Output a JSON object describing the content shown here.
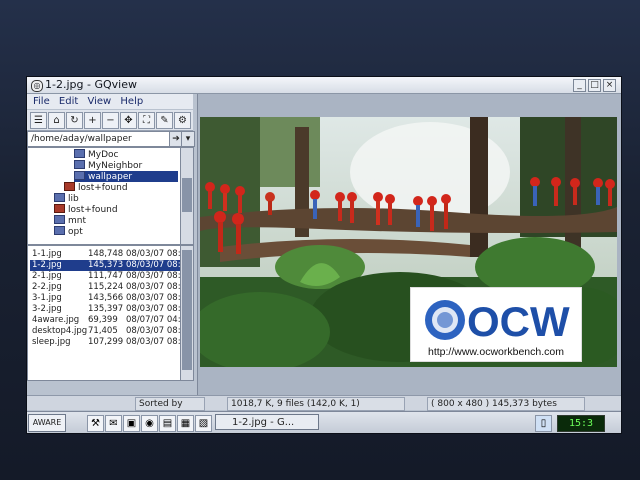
{
  "window": {
    "title": "1-2.jpg - GQview"
  },
  "menu": [
    "File",
    "Edit",
    "View",
    "Help"
  ],
  "path_field": {
    "value": "/home/aday/wallpaper"
  },
  "tree": {
    "items": [
      {
        "label": "MyDoc",
        "selected": false
      },
      {
        "label": "MyNeighbor",
        "selected": false
      },
      {
        "label": "wallpaper",
        "selected": true
      },
      {
        "label": "lost+found",
        "selected": false
      },
      {
        "label": "lib",
        "selected": false
      },
      {
        "label": "lost+found",
        "selected": false
      },
      {
        "label": "mnt",
        "selected": false
      },
      {
        "label": "opt",
        "selected": false
      }
    ]
  },
  "files": {
    "rows": [
      {
        "name": "1-1.jpg",
        "size": "148,748",
        "date": "08/03/07 08:",
        "selected": false
      },
      {
        "name": "1-2.jpg",
        "size": "145,373",
        "date": "08/03/07 08:",
        "selected": true
      },
      {
        "name": "2-1.jpg",
        "size": "111,747",
        "date": "08/03/07 08:",
        "selected": false
      },
      {
        "name": "2-2.jpg",
        "size": "115,224",
        "date": "08/03/07 08:",
        "selected": false
      },
      {
        "name": "3-1.jpg",
        "size": "143,566",
        "date": "08/03/07 08:",
        "selected": false
      },
      {
        "name": "3-2.jpg",
        "size": "135,397",
        "date": "08/03/07 08:",
        "selected": false
      },
      {
        "name": "4aware.jpg",
        "size": "69,399",
        "date": "08/07/07 04:",
        "selected": false
      },
      {
        "name": "desktop4.jpg",
        "size": "71,405",
        "date": "08/03/07 08:",
        "selected": false
      },
      {
        "name": "sleep.jpg",
        "size": "107,299",
        "date": "08/03/07 08:",
        "selected": false
      }
    ]
  },
  "status": {
    "sort": "Sorted by name",
    "summary": "1018,7 K, 9 files (142,0 K, 1)",
    "image_info": "( 800 x 480 ) 145,373 bytes"
  },
  "taskbar": {
    "start_label": "AWARE",
    "window_button": "1-2.jpg - G...",
    "clock": "15:3"
  },
  "watermark": {
    "logo_text": "OCW",
    "url": "http://www.ocworkbench.com"
  },
  "colors": {
    "selection": "#1f3d8c",
    "clock_text": "#6cff5a",
    "logo_blue": "#1e4fa8"
  }
}
